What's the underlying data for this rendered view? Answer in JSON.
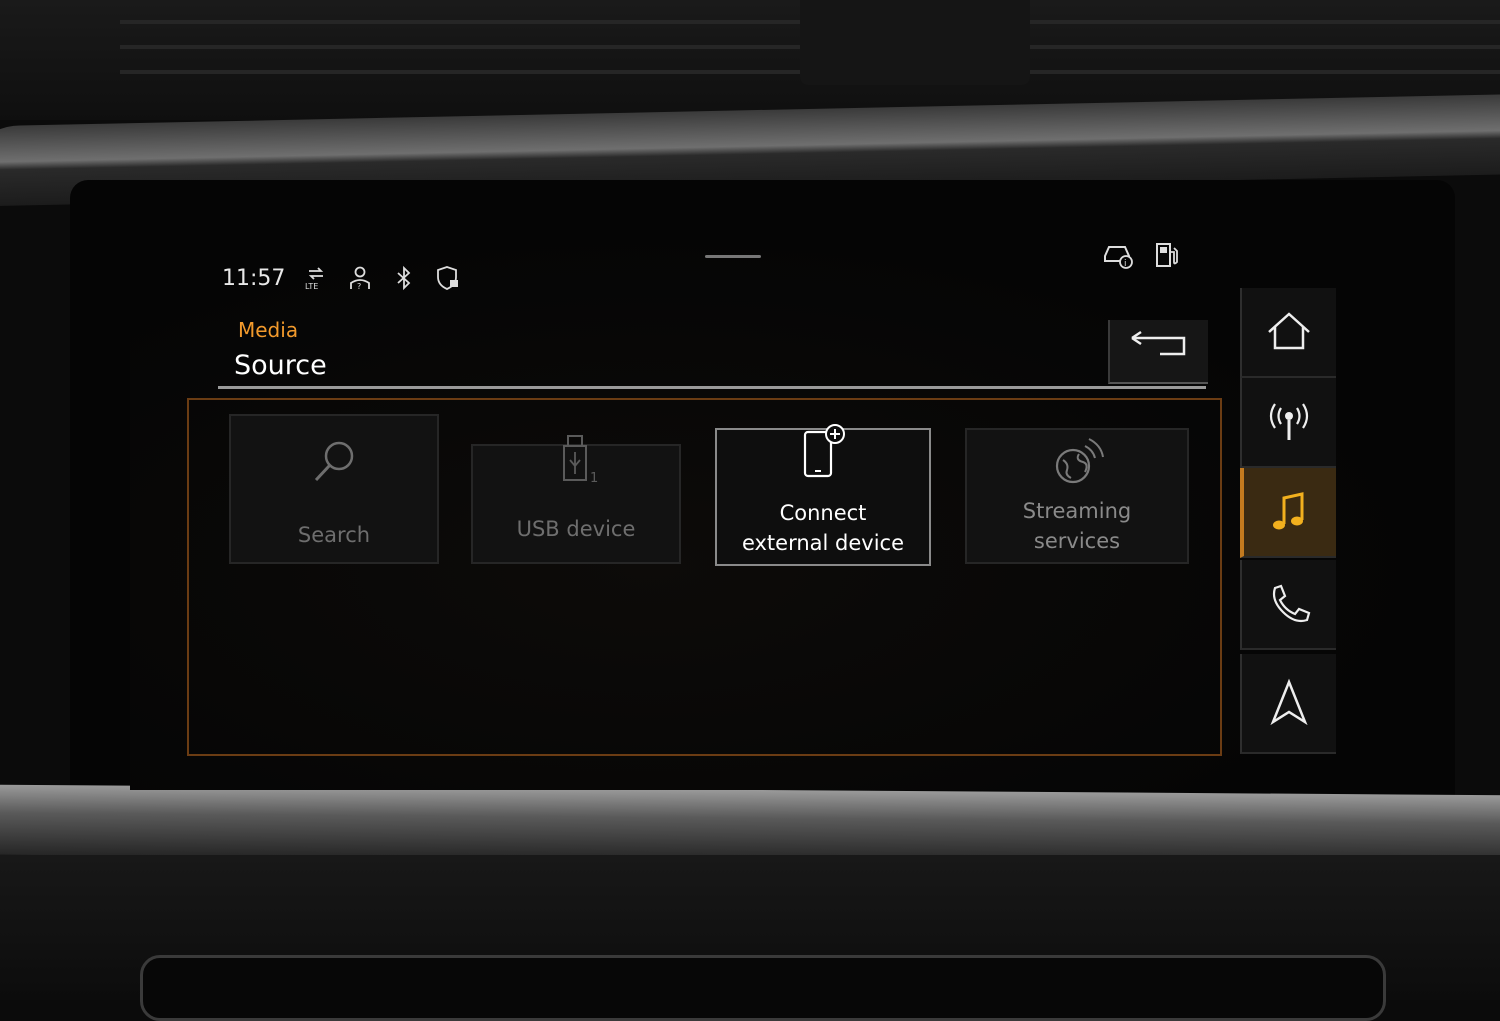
{
  "status": {
    "time": "11:57",
    "icons": [
      "network-lte-icon",
      "profile-help-icon",
      "bluetooth-icon",
      "privacy-shield-icon",
      "car-info-icon",
      "fuel-icon"
    ]
  },
  "header": {
    "section": "Media",
    "title": "Source",
    "back_icon": "back-arrow-icon"
  },
  "sources": [
    {
      "label": "Search",
      "icon": "search-icon",
      "enabled": false
    },
    {
      "label": "USB device",
      "icon": "usb-icon",
      "badge": "1",
      "enabled": false
    },
    {
      "label_line1": "Connect",
      "label_line2": "external device",
      "icon": "phone-add-icon",
      "enabled": true
    },
    {
      "label_line1": "Streaming",
      "label_line2": "services",
      "icon": "streaming-globe-icon",
      "enabled": false
    }
  ],
  "rail": [
    {
      "icon": "home-icon",
      "selected": false
    },
    {
      "icon": "radio-icon",
      "selected": false
    },
    {
      "icon": "music-note-icon",
      "selected": true
    },
    {
      "icon": "phone-icon",
      "selected": false
    },
    {
      "icon": "navigation-icon",
      "selected": false
    }
  ],
  "colors": {
    "accent": "#f29a2c",
    "frame": "#6b3c13",
    "text": "#ffffff",
    "dim_text": "#6e6e6e"
  }
}
